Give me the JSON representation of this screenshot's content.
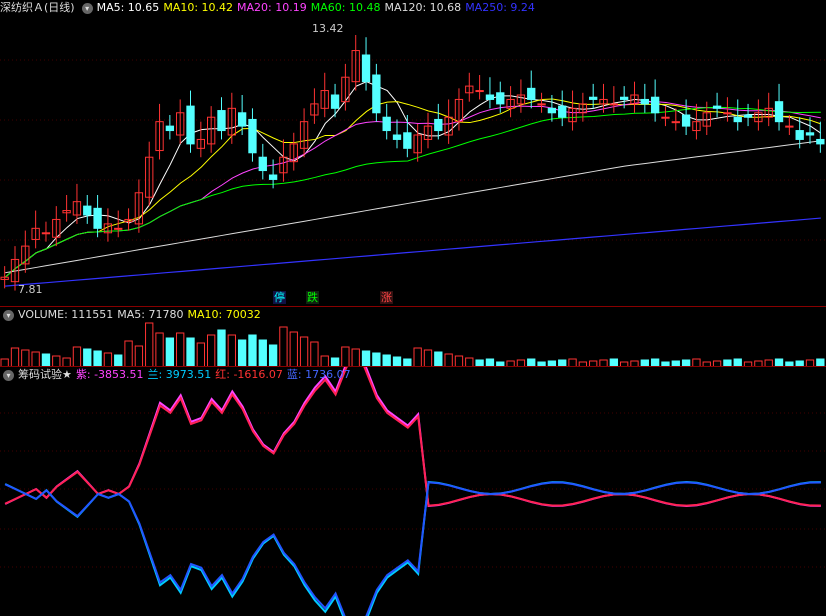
{
  "main": {
    "title": "深纺织Ａ(日线)",
    "ma": [
      {
        "label": "MA5: 10.65",
        "color": "#ffffff"
      },
      {
        "label": "MA10: 10.42",
        "color": "#ffff00"
      },
      {
        "label": "MA20: 10.19",
        "color": "#ff44ff"
      },
      {
        "label": "MA60: 10.48",
        "color": "#00ff00"
      },
      {
        "label": "MA120: 10.68",
        "color": "#dddddd"
      },
      {
        "label": "MA250: 9.24",
        "color": "#3333ff"
      }
    ],
    "high_label": "13.42",
    "low_label": "7.81",
    "tags": [
      {
        "text": "停",
        "color": "#00ffff"
      },
      {
        "text": "跌",
        "color": "#00ff00"
      },
      {
        "text": "涨",
        "color": "#ff4444"
      }
    ]
  },
  "volume": {
    "labels": [
      {
        "text": "VOLUME: 111551",
        "color": "#dddddd"
      },
      {
        "text": "MA5: 71780",
        "color": "#dddddd"
      },
      {
        "text": "MA10: 70032",
        "color": "#ffff00"
      }
    ]
  },
  "indicator": {
    "title": "筹码试验★",
    "labels": [
      {
        "text": "紫: -3853.51",
        "color": "#ff44ff"
      },
      {
        "text": "兰: 3973.51",
        "color": "#00ccff"
      },
      {
        "text": "红: -1616.07",
        "color": "#ff3333"
      },
      {
        "text": "蓝: 1736.07",
        "color": "#4466ff"
      }
    ]
  },
  "chart_data": {
    "type": "candlestick",
    "price_range": [
      7.5,
      13.8
    ],
    "closes": [
      7.9,
      8.3,
      8.6,
      9.0,
      8.9,
      9.2,
      9.4,
      9.6,
      9.3,
      9.0,
      9.1,
      9.0,
      9.2,
      9.8,
      10.6,
      11.4,
      11.2,
      11.6,
      10.9,
      11.0,
      11.5,
      11.2,
      11.7,
      11.3,
      10.7,
      10.3,
      10.1,
      10.6,
      10.9,
      11.4,
      11.8,
      12.1,
      11.7,
      12.4,
      13.0,
      12.3,
      11.6,
      11.2,
      11.0,
      10.8,
      11.1,
      11.3,
      11.2,
      11.5,
      11.9,
      12.2,
      12.1,
      11.9,
      11.8,
      11.9,
      12.0,
      11.9,
      11.8,
      11.6,
      11.5,
      11.7,
      11.8,
      11.9,
      11.9,
      11.8,
      11.9,
      12.0,
      11.8,
      11.6,
      11.5,
      11.4,
      11.3,
      11.4,
      11.6,
      11.7,
      11.6,
      11.4,
      11.5,
      11.6,
      11.7,
      11.4,
      11.3,
      11.0,
      11.1,
      10.9
    ]
  }
}
